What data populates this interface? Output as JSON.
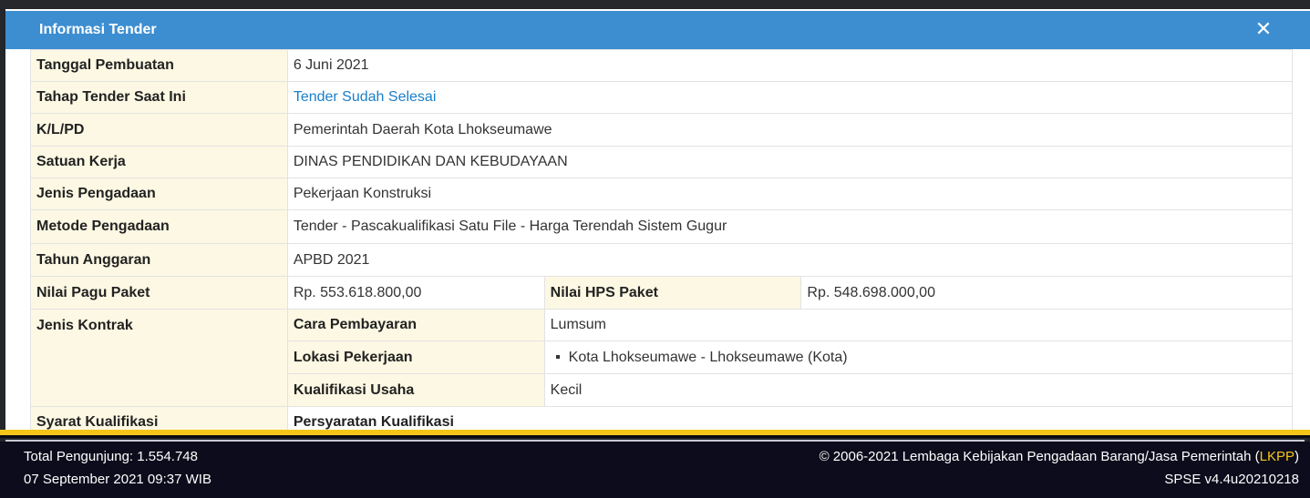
{
  "modal": {
    "title": "Informasi Tender",
    "close_icon": "close-icon"
  },
  "rows": {
    "tanggal_pembuatan": {
      "label": "Tanggal Pembuatan",
      "value": "6 Juni 2021"
    },
    "tahap_tender": {
      "label": "Tahap Tender Saat Ini",
      "value": "Tender Sudah Selesai"
    },
    "klpd": {
      "label": "K/L/PD",
      "value": "Pemerintah Daerah Kota Lhokseumawe"
    },
    "satuan_kerja": {
      "label": "Satuan Kerja",
      "value": "DINAS PENDIDIKAN DAN KEBUDAYAAN"
    },
    "jenis_pengadaan": {
      "label": "Jenis Pengadaan",
      "value": "Pekerjaan Konstruksi"
    },
    "metode_pengadaan": {
      "label": "Metode Pengadaan",
      "value": "Tender - Pascakualifikasi Satu File - Harga Terendah Sistem Gugur"
    },
    "tahun_anggaran": {
      "label": "Tahun Anggaran",
      "value": "APBD 2021"
    },
    "nilai_pagu": {
      "label": "Nilai Pagu Paket",
      "value": "Rp. 553.618.800,00"
    },
    "nilai_hps": {
      "label": "Nilai HPS Paket",
      "value": "Rp. 548.698.000,00"
    },
    "jenis_kontrak": {
      "label": "Jenis Kontrak",
      "cara_pembayaran": {
        "label": "Cara Pembayaran",
        "value": "Lumsum"
      },
      "lokasi_pekerjaan": {
        "label": "Lokasi Pekerjaan",
        "value": "Kota Lhokseumawe - Lhokseumawe (Kota)"
      },
      "kualifikasi_usaha": {
        "label": "Kualifikasi Usaha",
        "value": "Kecil"
      }
    },
    "syarat_kualifikasi": {
      "label": "Syarat Kualifikasi",
      "value": "Persyaratan Kualifikasi"
    }
  },
  "footer": {
    "visitors": "Total Pengunjung: 1.554.748",
    "datetime": "07 September 2021 09:37 WIB",
    "copyright_prefix": "© 2006-2021 Lembaga Kebijakan Pengadaan Barang/Jasa Pemerintah (",
    "copyright_link": "LKPP",
    "copyright_suffix": ")",
    "version": "SPSE v4.4u20210218"
  },
  "colors": {
    "header": "#3d8ed1",
    "label_bg": "#fcf8e3",
    "link": "#1a7fc9",
    "footer_bg": "#0c0c1c",
    "footer_accent": "#f5c518"
  }
}
